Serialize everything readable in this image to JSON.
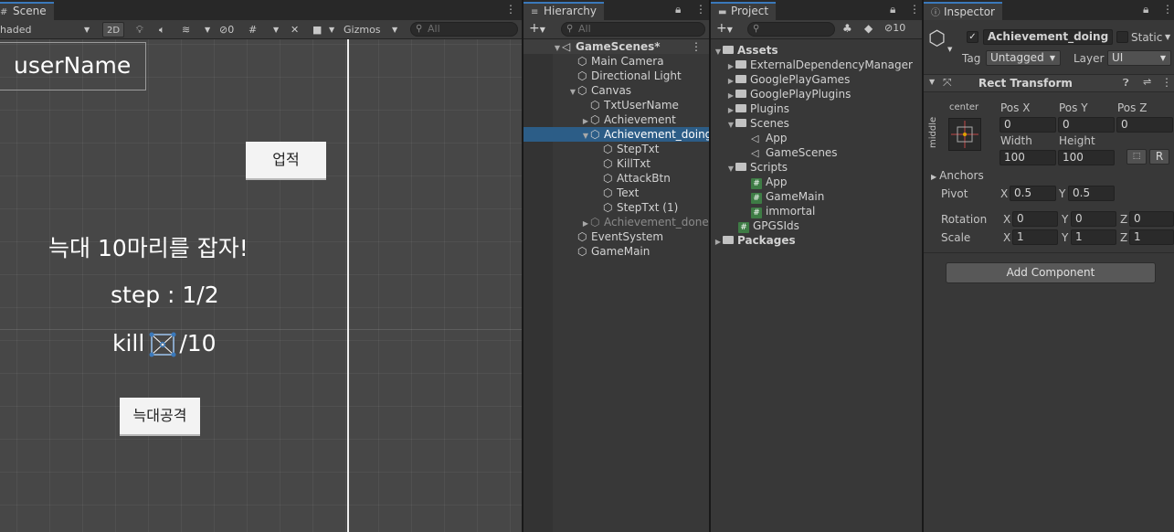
{
  "scene": {
    "tab_label": "Scene",
    "shading_mode": "haded",
    "btn_2d": "2D",
    "hidden_count": "0",
    "gizmos_label": "Gizmos",
    "search_placeholder": "All",
    "username_text": "userName",
    "achievement_button": "업적",
    "mission_text": "늑대 10마리를 잡자!",
    "step_text": "step : 1/2",
    "kill_prefix": "kill",
    "kill_suffix": "/10",
    "attack_button": "늑대공격"
  },
  "hierarchy": {
    "tab_label": "Hierarchy",
    "search_placeholder": "All",
    "scene_name": "GameScenes*",
    "items": [
      {
        "label": "Main Camera"
      },
      {
        "label": "Directional Light"
      },
      {
        "label": "Canvas"
      },
      {
        "label": "TxtUserName"
      },
      {
        "label": "Achievement"
      },
      {
        "label": "Achievement_doing"
      },
      {
        "label": "StepTxt"
      },
      {
        "label": "KillTxt"
      },
      {
        "label": "AttackBtn"
      },
      {
        "label": "Text"
      },
      {
        "label": "StepTxt (1)"
      },
      {
        "label": "Achievement_done"
      },
      {
        "label": "EventSystem"
      },
      {
        "label": "GameMain"
      }
    ]
  },
  "project": {
    "tab_label": "Project",
    "hidden_count": "10",
    "items": [
      {
        "label": "Assets"
      },
      {
        "label": "ExternalDependencyManager"
      },
      {
        "label": "GooglePlayGames"
      },
      {
        "label": "GooglePlayPlugins"
      },
      {
        "label": "Plugins"
      },
      {
        "label": "Scenes"
      },
      {
        "label": "App"
      },
      {
        "label": "GameScenes"
      },
      {
        "label": "Scripts"
      },
      {
        "label": "App"
      },
      {
        "label": "GameMain"
      },
      {
        "label": "immortal"
      },
      {
        "label": "GPGSIds"
      },
      {
        "label": "Packages"
      }
    ]
  },
  "inspector": {
    "tab_label": "Inspector",
    "object_name": "Achievement_doing",
    "static_label": "Static",
    "tag_label": "Tag",
    "tag_value": "Untagged",
    "layer_label": "Layer",
    "layer_value": "UI",
    "component_title": "Rect Transform",
    "anchor_h": "center",
    "anchor_v": "middle",
    "pos_x_label": "Pos X",
    "pos_y_label": "Pos Y",
    "pos_z_label": "Pos Z",
    "pos_x": "0",
    "pos_y": "0",
    "pos_z": "0",
    "width_label": "Width",
    "height_label": "Height",
    "width": "100",
    "height": "100",
    "r_button": "R",
    "anchors_label": "Anchors",
    "pivot_label": "Pivot",
    "pivot_x": "0.5",
    "pivot_y": "0.5",
    "rotation_label": "Rotation",
    "rot_x": "0",
    "rot_y": "0",
    "rot_z": "0",
    "scale_label": "Scale",
    "scale_x": "1",
    "scale_y": "1",
    "scale_z": "1",
    "x_label": "X",
    "y_label": "Y",
    "z_label": "Z",
    "add_component": "Add Component"
  }
}
